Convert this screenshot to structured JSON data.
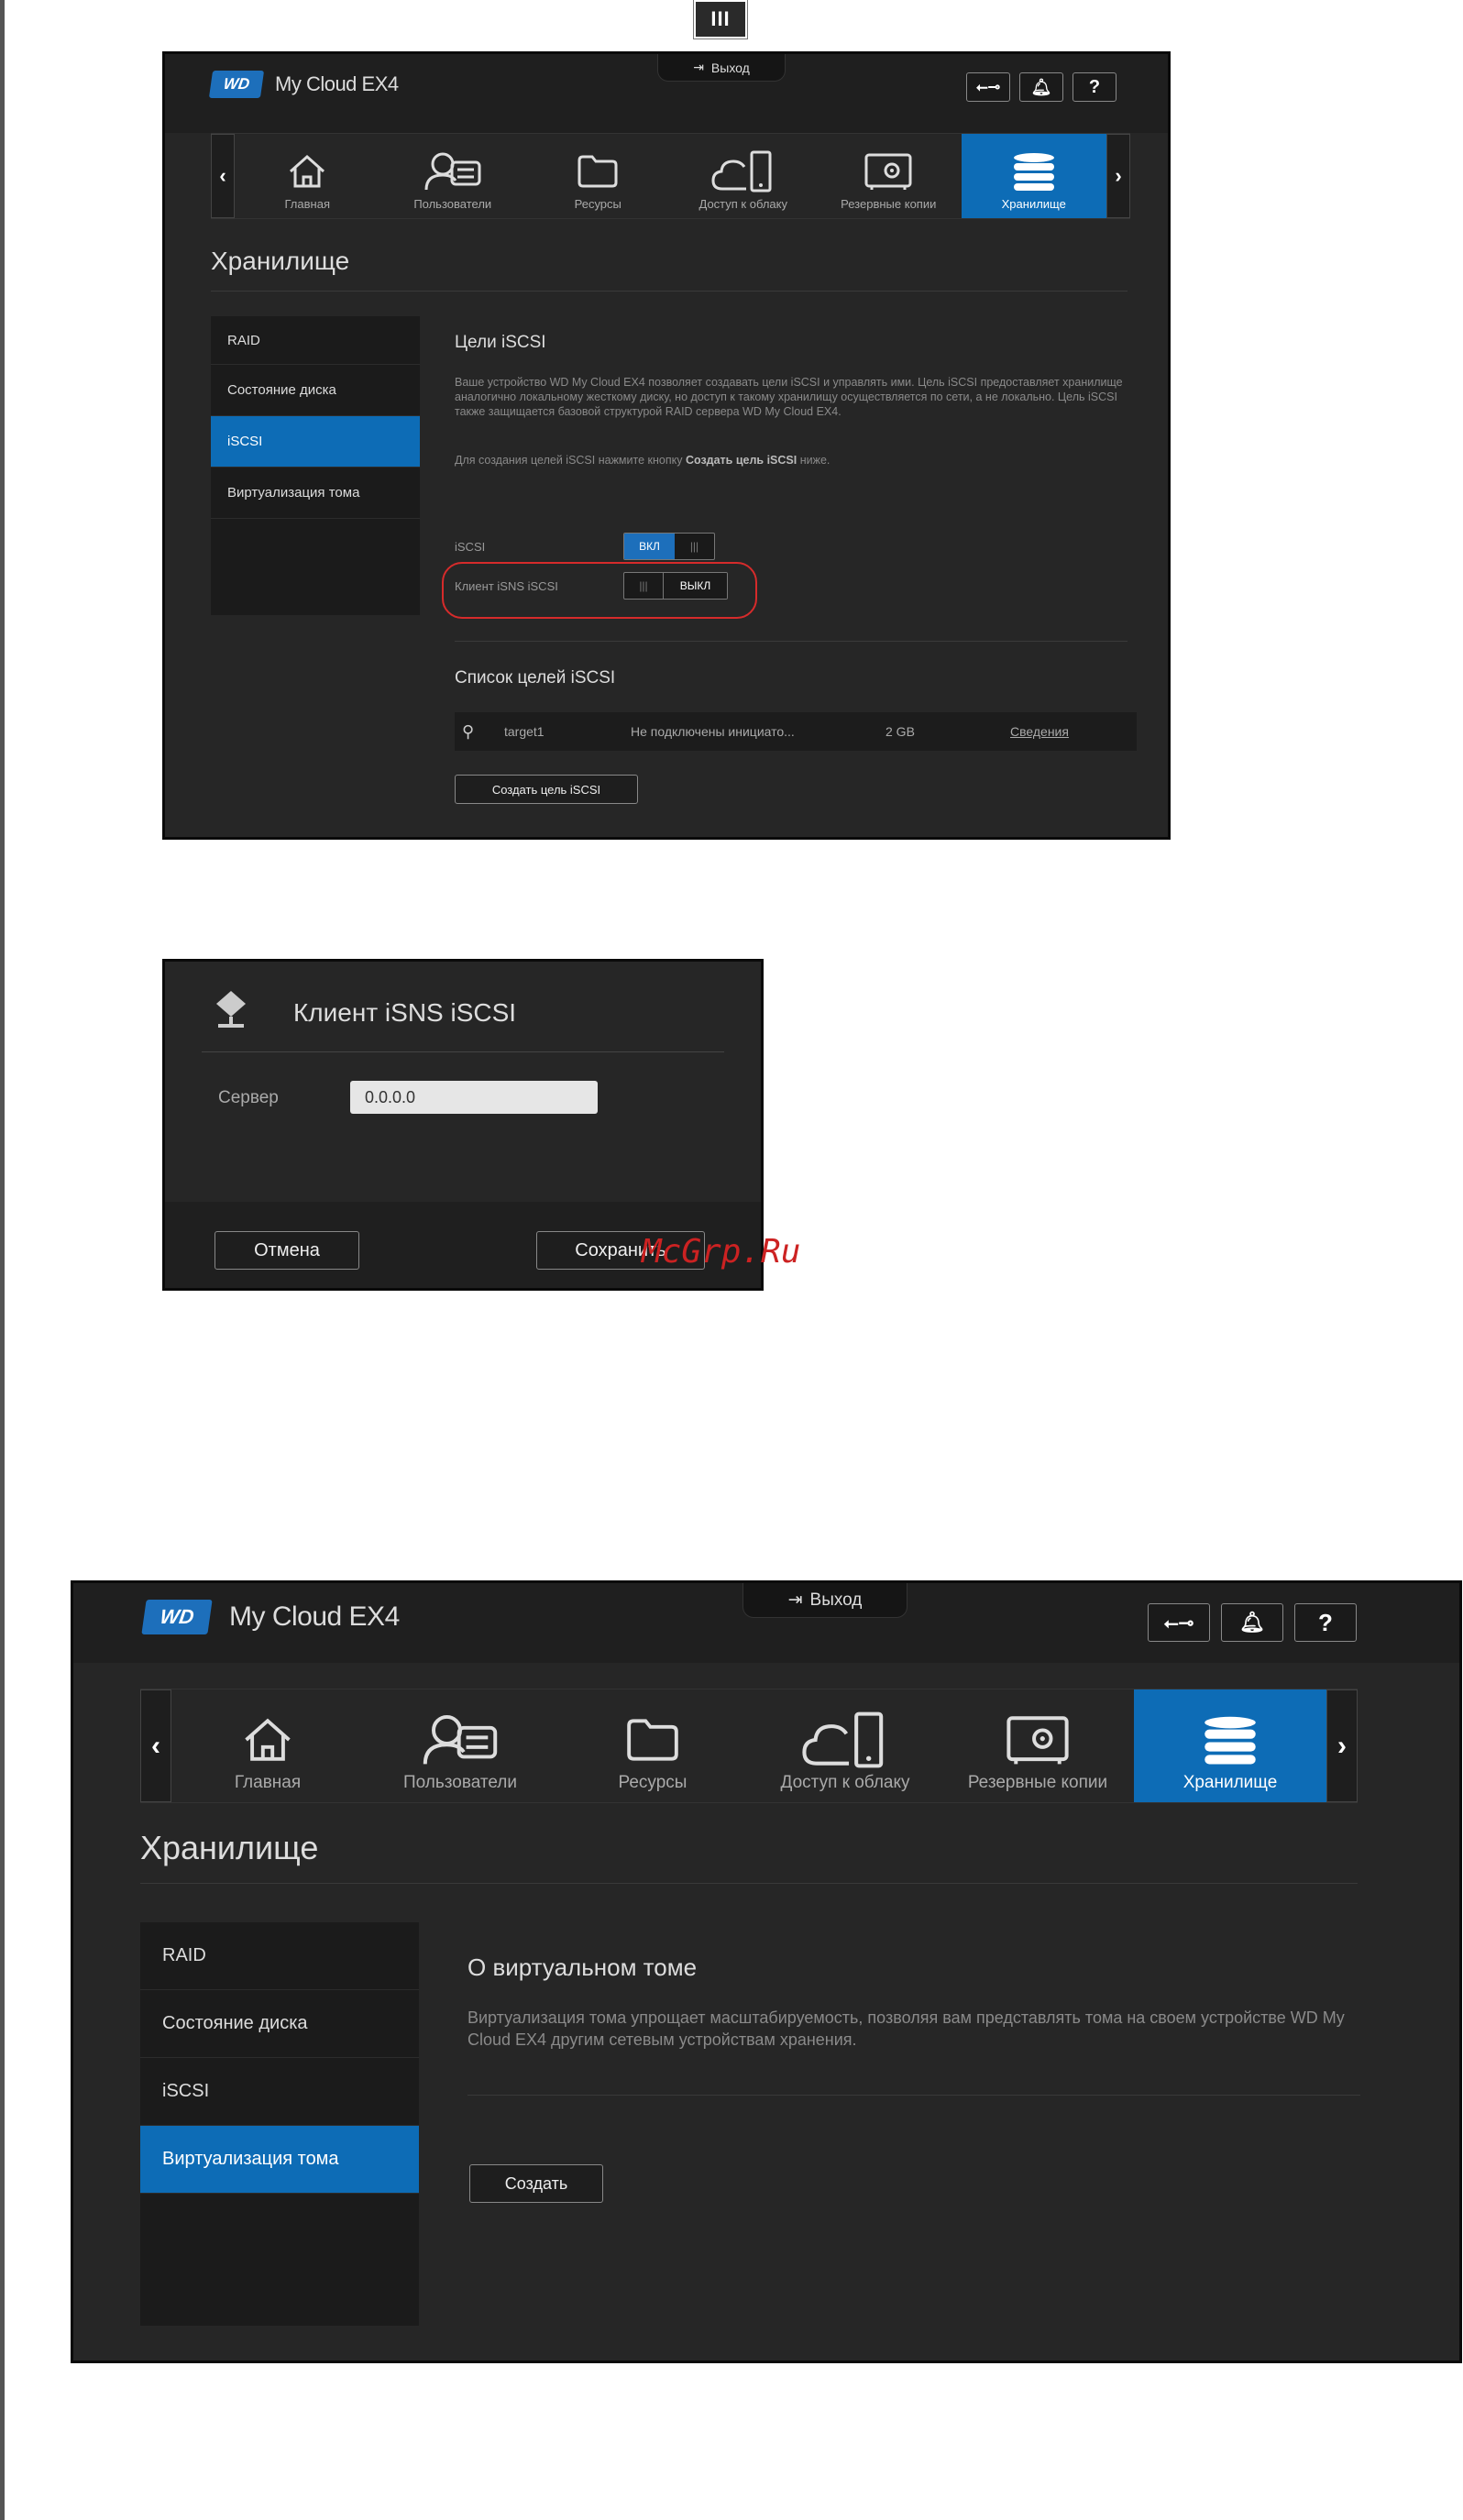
{
  "header": {
    "product": "My Cloud EX4",
    "logo": "WD",
    "exit_label": "Выход",
    "help": "?"
  },
  "nav": [
    "Главная",
    "Пользователи",
    "Ресурсы",
    "Доступ к облаку",
    "Резервные копии",
    "Хранилище"
  ],
  "page_title": "Хранилище",
  "sidebar": [
    "RAID",
    "Состояние диска",
    "iSCSI",
    "Виртуализация тома"
  ],
  "screen1": {
    "heading": "Цели iSCSI",
    "desc1": "Ваше устройство WD My Cloud EX4 позволяет создавать цели iSCSI и управлять ими. Цель iSCSI предоставляет хранилище аналогично локальному жесткому диску, но доступ к такому хранилищу осуществляется по сети, а не локально. Цель iSCSI также защищается базовой структурой RAID сервера WD My Cloud EX4.",
    "desc2_pre": "Для создания целей iSCSI нажмите кнопку ",
    "desc2_bold": "Создать цель iSCSI",
    "desc2_post": " ниже.",
    "iscsi_label": "iSCSI",
    "toggle_on": "ВКЛ",
    "isns_label": "Клиент iSNS iSCSI",
    "toggle_off": "ВЫКЛ",
    "grip": "|||",
    "list_title": "Список целей iSCSI",
    "target": {
      "name": "target1",
      "status": "Не подключены инициато...",
      "size": "2 GB",
      "link": "Сведения"
    },
    "create_btn": "Создать цель iSCSI"
  },
  "dialog": {
    "title": "Клиент iSNS iSCSI",
    "server_label": "Сервер",
    "server_value": "0.0.0.0",
    "cancel": "Отмена",
    "save": "Сохранить"
  },
  "screen2": {
    "heading": "О виртуальном томе",
    "desc": "Виртуализация тома упрощает масштабируемость, позволяя вам представлять тома на своем устройстве WD My Cloud EX4 другим сетевым устройствам хранения.",
    "create_btn": "Создать"
  },
  "page_marker": "III",
  "watermark": "McGrp.Ru"
}
